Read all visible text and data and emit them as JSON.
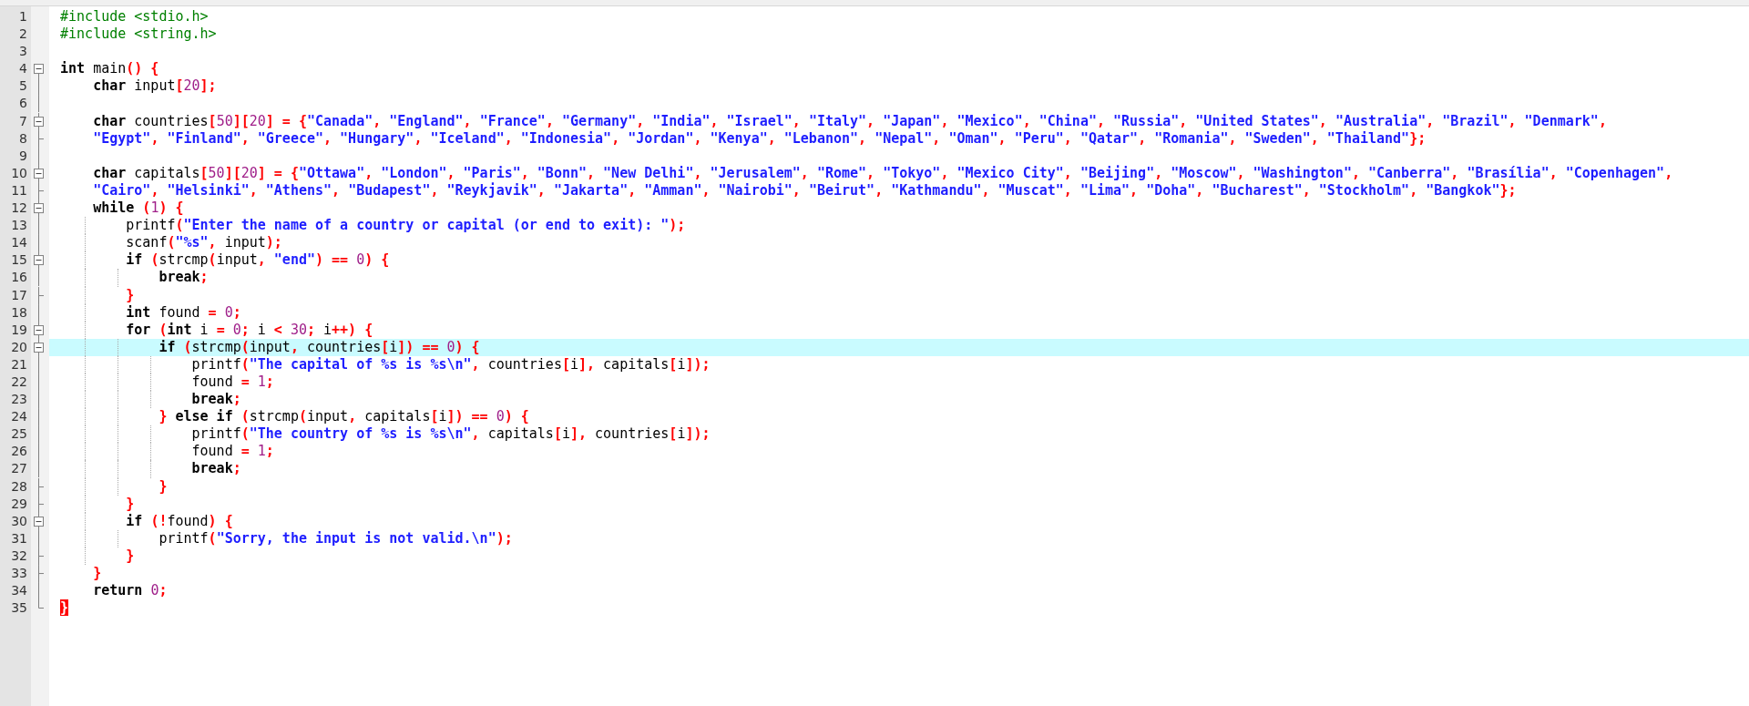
{
  "editor": {
    "lines": [
      {
        "number": "1",
        "kind": "plain",
        "current": false,
        "tokens": [
          {
            "kind": "pp",
            "text": "#include <stdio.h>"
          }
        ]
      },
      {
        "number": "2",
        "kind": "plain",
        "current": false,
        "tokens": [
          {
            "kind": "pp",
            "text": "#include <string.h>"
          }
        ]
      },
      {
        "number": "3",
        "kind": "plain",
        "current": false
      },
      {
        "number": "4",
        "kind": "fold-open",
        "current": false,
        "tokens": [
          {
            "kind": "kw",
            "text": "int"
          },
          {
            "kind": "id",
            "text": " main"
          },
          {
            "kind": "op",
            "text": "() {"
          }
        ]
      },
      {
        "number": "5",
        "kind": "fold-body",
        "current": false,
        "tokens": [
          {
            "kind": "kw",
            "text": "    char"
          },
          {
            "kind": "id",
            "text": " input"
          },
          {
            "kind": "op",
            "text": "["
          },
          {
            "kind": "num",
            "text": "20"
          },
          {
            "kind": "op",
            "text": "];"
          }
        ]
      },
      {
        "number": "6",
        "kind": "fold-body",
        "current": false
      },
      {
        "number": "7",
        "kind": "fold-open",
        "current": false,
        "tokens": [
          {
            "kind": "kw",
            "text": "    char"
          },
          {
            "kind": "id",
            "text": " countries"
          },
          {
            "kind": "op",
            "text": "["
          },
          {
            "kind": "num",
            "text": "50"
          },
          {
            "kind": "op",
            "text": "]["
          },
          {
            "kind": "num",
            "text": "20"
          },
          {
            "kind": "op",
            "text": "] = {"
          },
          {
            "kind": "str",
            "text": "\"Canada\""
          },
          {
            "kind": "op",
            "text": ", "
          },
          {
            "kind": "str",
            "text": "\"England\""
          },
          {
            "kind": "op",
            "text": ", "
          },
          {
            "kind": "str",
            "text": "\"France\""
          },
          {
            "kind": "op",
            "text": ", "
          },
          {
            "kind": "str",
            "text": "\"Germany\""
          },
          {
            "kind": "op",
            "text": ", "
          },
          {
            "kind": "str",
            "text": "\"India\""
          },
          {
            "kind": "op",
            "text": ", "
          },
          {
            "kind": "str",
            "text": "\"Israel\""
          },
          {
            "kind": "op",
            "text": ", "
          },
          {
            "kind": "str",
            "text": "\"Italy\""
          },
          {
            "kind": "op",
            "text": ", "
          },
          {
            "kind": "str",
            "text": "\"Japan\""
          },
          {
            "kind": "op",
            "text": ", "
          },
          {
            "kind": "str",
            "text": "\"Mexico\""
          },
          {
            "kind": "op",
            "text": ", "
          },
          {
            "kind": "str",
            "text": "\"China\""
          },
          {
            "kind": "op",
            "text": ", "
          },
          {
            "kind": "str",
            "text": "\"Russia\""
          },
          {
            "kind": "op",
            "text": ", "
          },
          {
            "kind": "str",
            "text": "\"United States\""
          },
          {
            "kind": "op",
            "text": ", "
          },
          {
            "kind": "str",
            "text": "\"Australia\""
          },
          {
            "kind": "op",
            "text": ", "
          },
          {
            "kind": "str",
            "text": "\"Brazil\""
          },
          {
            "kind": "op",
            "text": ", "
          },
          {
            "kind": "str",
            "text": "\"Denmark\""
          },
          {
            "kind": "op",
            "text": ","
          }
        ]
      },
      {
        "number": "8",
        "kind": "fold-end",
        "current": false,
        "tokens": [
          {
            "kind": "str",
            "text": "    \"Egypt\""
          },
          {
            "kind": "op",
            "text": ", "
          },
          {
            "kind": "str",
            "text": "\"Finland\""
          },
          {
            "kind": "op",
            "text": ", "
          },
          {
            "kind": "str",
            "text": "\"Greece\""
          },
          {
            "kind": "op",
            "text": ", "
          },
          {
            "kind": "str",
            "text": "\"Hungary\""
          },
          {
            "kind": "op",
            "text": ", "
          },
          {
            "kind": "str",
            "text": "\"Iceland\""
          },
          {
            "kind": "op",
            "text": ", "
          },
          {
            "kind": "str",
            "text": "\"Indonesia\""
          },
          {
            "kind": "op",
            "text": ", "
          },
          {
            "kind": "str",
            "text": "\"Jordan\""
          },
          {
            "kind": "op",
            "text": ", "
          },
          {
            "kind": "str",
            "text": "\"Kenya\""
          },
          {
            "kind": "op",
            "text": ", "
          },
          {
            "kind": "str",
            "text": "\"Lebanon\""
          },
          {
            "kind": "op",
            "text": ", "
          },
          {
            "kind": "str",
            "text": "\"Nepal\""
          },
          {
            "kind": "op",
            "text": ", "
          },
          {
            "kind": "str",
            "text": "\"Oman\""
          },
          {
            "kind": "op",
            "text": ", "
          },
          {
            "kind": "str",
            "text": "\"Peru\""
          },
          {
            "kind": "op",
            "text": ", "
          },
          {
            "kind": "str",
            "text": "\"Qatar\""
          },
          {
            "kind": "op",
            "text": ", "
          },
          {
            "kind": "str",
            "text": "\"Romania\""
          },
          {
            "kind": "op",
            "text": ", "
          },
          {
            "kind": "str",
            "text": "\"Sweden\""
          },
          {
            "kind": "op",
            "text": ", "
          },
          {
            "kind": "str",
            "text": "\"Thailand\""
          },
          {
            "kind": "op",
            "text": "};"
          }
        ]
      },
      {
        "number": "9",
        "kind": "fold-body",
        "current": false
      },
      {
        "number": "10",
        "kind": "fold-open",
        "current": false,
        "tokens": [
          {
            "kind": "kw",
            "text": "    char"
          },
          {
            "kind": "id",
            "text": " capitals"
          },
          {
            "kind": "op",
            "text": "["
          },
          {
            "kind": "num",
            "text": "50"
          },
          {
            "kind": "op",
            "text": "]["
          },
          {
            "kind": "num",
            "text": "20"
          },
          {
            "kind": "op",
            "text": "] = {"
          },
          {
            "kind": "str",
            "text": "\"Ottawa\""
          },
          {
            "kind": "op",
            "text": ", "
          },
          {
            "kind": "str",
            "text": "\"London\""
          },
          {
            "kind": "op",
            "text": ", "
          },
          {
            "kind": "str",
            "text": "\"Paris\""
          },
          {
            "kind": "op",
            "text": ", "
          },
          {
            "kind": "str",
            "text": "\"Bonn\""
          },
          {
            "kind": "op",
            "text": ", "
          },
          {
            "kind": "str",
            "text": "\"New Delhi\""
          },
          {
            "kind": "op",
            "text": ", "
          },
          {
            "kind": "str",
            "text": "\"Jerusalem\""
          },
          {
            "kind": "op",
            "text": ", "
          },
          {
            "kind": "str",
            "text": "\"Rome\""
          },
          {
            "kind": "op",
            "text": ", "
          },
          {
            "kind": "str",
            "text": "\"Tokyo\""
          },
          {
            "kind": "op",
            "text": ", "
          },
          {
            "kind": "str",
            "text": "\"Mexico City\""
          },
          {
            "kind": "op",
            "text": ", "
          },
          {
            "kind": "str",
            "text": "\"Beijing\""
          },
          {
            "kind": "op",
            "text": ", "
          },
          {
            "kind": "str",
            "text": "\"Moscow\""
          },
          {
            "kind": "op",
            "text": ", "
          },
          {
            "kind": "str",
            "text": "\"Washington\""
          },
          {
            "kind": "op",
            "text": ", "
          },
          {
            "kind": "str",
            "text": "\"Canberra\""
          },
          {
            "kind": "op",
            "text": ", "
          },
          {
            "kind": "str",
            "text": "\"Brasília\""
          },
          {
            "kind": "op",
            "text": ", "
          },
          {
            "kind": "str",
            "text": "\"Copenhagen\""
          },
          {
            "kind": "op",
            "text": ","
          }
        ]
      },
      {
        "number": "11",
        "kind": "fold-end",
        "current": false,
        "tokens": [
          {
            "kind": "str",
            "text": "    \"Cairo\""
          },
          {
            "kind": "op",
            "text": ", "
          },
          {
            "kind": "str",
            "text": "\"Helsinki\""
          },
          {
            "kind": "op",
            "text": ", "
          },
          {
            "kind": "str",
            "text": "\"Athens\""
          },
          {
            "kind": "op",
            "text": ", "
          },
          {
            "kind": "str",
            "text": "\"Budapest\""
          },
          {
            "kind": "op",
            "text": ", "
          },
          {
            "kind": "str",
            "text": "\"Reykjavik\""
          },
          {
            "kind": "op",
            "text": ", "
          },
          {
            "kind": "str",
            "text": "\"Jakarta\""
          },
          {
            "kind": "op",
            "text": ", "
          },
          {
            "kind": "str",
            "text": "\"Amman\""
          },
          {
            "kind": "op",
            "text": ", "
          },
          {
            "kind": "str",
            "text": "\"Nairobi\""
          },
          {
            "kind": "op",
            "text": ", "
          },
          {
            "kind": "str",
            "text": "\"Beirut\""
          },
          {
            "kind": "op",
            "text": ", "
          },
          {
            "kind": "str",
            "text": "\"Kathmandu\""
          },
          {
            "kind": "op",
            "text": ", "
          },
          {
            "kind": "str",
            "text": "\"Muscat\""
          },
          {
            "kind": "op",
            "text": ", "
          },
          {
            "kind": "str",
            "text": "\"Lima\""
          },
          {
            "kind": "op",
            "text": ", "
          },
          {
            "kind": "str",
            "text": "\"Doha\""
          },
          {
            "kind": "op",
            "text": ", "
          },
          {
            "kind": "str",
            "text": "\"Bucharest\""
          },
          {
            "kind": "op",
            "text": ", "
          },
          {
            "kind": "str",
            "text": "\"Stockholm\""
          },
          {
            "kind": "op",
            "text": ", "
          },
          {
            "kind": "str",
            "text": "\"Bangkok\""
          },
          {
            "kind": "op",
            "text": "};"
          }
        ]
      },
      {
        "number": "12",
        "kind": "fold-open",
        "current": false,
        "tokens": [
          {
            "kind": "kw",
            "text": "    while "
          },
          {
            "kind": "op",
            "text": "("
          },
          {
            "kind": "num",
            "text": "1"
          },
          {
            "kind": "op",
            "text": ") {"
          }
        ]
      },
      {
        "number": "13",
        "kind": "fold-body",
        "current": false,
        "tokens": [
          {
            "kind": "id",
            "text": "        printf"
          },
          {
            "kind": "op",
            "text": "("
          },
          {
            "kind": "str",
            "text": "\"Enter the name of a country or capital (or end to exit): \""
          },
          {
            "kind": "op",
            "text": ");"
          }
        ]
      },
      {
        "number": "14",
        "kind": "fold-body",
        "current": false,
        "tokens": [
          {
            "kind": "id",
            "text": "        scanf"
          },
          {
            "kind": "op",
            "text": "("
          },
          {
            "kind": "str",
            "text": "\"%s\""
          },
          {
            "kind": "op",
            "text": ", "
          },
          {
            "kind": "id",
            "text": "input"
          },
          {
            "kind": "op",
            "text": ");"
          }
        ]
      },
      {
        "number": "15",
        "kind": "fold-open",
        "current": false,
        "tokens": [
          {
            "kind": "kw",
            "text": "        if "
          },
          {
            "kind": "op",
            "text": "("
          },
          {
            "kind": "id",
            "text": "strcmp"
          },
          {
            "kind": "op",
            "text": "("
          },
          {
            "kind": "id",
            "text": "input"
          },
          {
            "kind": "op",
            "text": ", "
          },
          {
            "kind": "str",
            "text": "\"end\""
          },
          {
            "kind": "op",
            "text": ") == "
          },
          {
            "kind": "num",
            "text": "0"
          },
          {
            "kind": "op",
            "text": ") {"
          }
        ]
      },
      {
        "number": "16",
        "kind": "fold-body",
        "current": false,
        "tokens": [
          {
            "kind": "kw",
            "text": "            break"
          },
          {
            "kind": "op",
            "text": ";"
          }
        ]
      },
      {
        "number": "17",
        "kind": "fold-end",
        "current": false,
        "tokens": [
          {
            "kind": "op",
            "text": "        }"
          }
        ]
      },
      {
        "number": "18",
        "kind": "fold-body",
        "current": false,
        "tokens": [
          {
            "kind": "kw",
            "text": "        int"
          },
          {
            "kind": "id",
            "text": " found "
          },
          {
            "kind": "op",
            "text": "= "
          },
          {
            "kind": "num",
            "text": "0"
          },
          {
            "kind": "op",
            "text": ";"
          }
        ]
      },
      {
        "number": "19",
        "kind": "fold-open",
        "current": false,
        "tokens": [
          {
            "kind": "kw",
            "text": "        for "
          },
          {
            "kind": "op",
            "text": "("
          },
          {
            "kind": "kw",
            "text": "int"
          },
          {
            "kind": "id",
            "text": " i "
          },
          {
            "kind": "op",
            "text": "= "
          },
          {
            "kind": "num",
            "text": "0"
          },
          {
            "kind": "op",
            "text": "; "
          },
          {
            "kind": "id",
            "text": "i "
          },
          {
            "kind": "op",
            "text": "< "
          },
          {
            "kind": "num",
            "text": "30"
          },
          {
            "kind": "op",
            "text": "; "
          },
          {
            "kind": "id",
            "text": "i"
          },
          {
            "kind": "op",
            "text": "++) {"
          }
        ]
      },
      {
        "number": "20",
        "kind": "fold-open",
        "current": true,
        "tokens": [
          {
            "kind": "kw",
            "text": "            if "
          },
          {
            "kind": "op",
            "text": "("
          },
          {
            "kind": "id",
            "text": "strcmp"
          },
          {
            "kind": "op",
            "text": "("
          },
          {
            "kind": "id",
            "text": "input"
          },
          {
            "kind": "op",
            "text": ", "
          },
          {
            "kind": "id",
            "text": "countries"
          },
          {
            "kind": "op",
            "text": "["
          },
          {
            "kind": "id",
            "text": "i"
          },
          {
            "kind": "op",
            "text": "]) == "
          },
          {
            "kind": "num",
            "text": "0"
          },
          {
            "kind": "op",
            "text": ") {"
          }
        ]
      },
      {
        "number": "21",
        "kind": "fold-body",
        "current": false,
        "tokens": [
          {
            "kind": "id",
            "text": "                printf"
          },
          {
            "kind": "op",
            "text": "("
          },
          {
            "kind": "str",
            "text": "\"The capital of %s is %s\\n\""
          },
          {
            "kind": "op",
            "text": ", "
          },
          {
            "kind": "id",
            "text": "countries"
          },
          {
            "kind": "op",
            "text": "["
          },
          {
            "kind": "id",
            "text": "i"
          },
          {
            "kind": "op",
            "text": "], "
          },
          {
            "kind": "id",
            "text": "capitals"
          },
          {
            "kind": "op",
            "text": "["
          },
          {
            "kind": "id",
            "text": "i"
          },
          {
            "kind": "op",
            "text": "]);"
          }
        ]
      },
      {
        "number": "22",
        "kind": "fold-body",
        "current": false,
        "tokens": [
          {
            "kind": "id",
            "text": "                found "
          },
          {
            "kind": "op",
            "text": "= "
          },
          {
            "kind": "num",
            "text": "1"
          },
          {
            "kind": "op",
            "text": ";"
          }
        ]
      },
      {
        "number": "23",
        "kind": "fold-body",
        "current": false,
        "tokens": [
          {
            "kind": "kw",
            "text": "                break"
          },
          {
            "kind": "op",
            "text": ";"
          }
        ]
      },
      {
        "number": "24",
        "kind": "fold-body",
        "current": false,
        "tokens": [
          {
            "kind": "op",
            "text": "            } "
          },
          {
            "kind": "kw",
            "text": "else if "
          },
          {
            "kind": "op",
            "text": "("
          },
          {
            "kind": "id",
            "text": "strcmp"
          },
          {
            "kind": "op",
            "text": "("
          },
          {
            "kind": "id",
            "text": "input"
          },
          {
            "kind": "op",
            "text": ", "
          },
          {
            "kind": "id",
            "text": "capitals"
          },
          {
            "kind": "op",
            "text": "["
          },
          {
            "kind": "id",
            "text": "i"
          },
          {
            "kind": "op",
            "text": "]) == "
          },
          {
            "kind": "num",
            "text": "0"
          },
          {
            "kind": "op",
            "text": ") {"
          }
        ]
      },
      {
        "number": "25",
        "kind": "fold-body",
        "current": false,
        "tokens": [
          {
            "kind": "id",
            "text": "                printf"
          },
          {
            "kind": "op",
            "text": "("
          },
          {
            "kind": "str",
            "text": "\"The country of %s is %s\\n\""
          },
          {
            "kind": "op",
            "text": ", "
          },
          {
            "kind": "id",
            "text": "capitals"
          },
          {
            "kind": "op",
            "text": "["
          },
          {
            "kind": "id",
            "text": "i"
          },
          {
            "kind": "op",
            "text": "], "
          },
          {
            "kind": "id",
            "text": "countries"
          },
          {
            "kind": "op",
            "text": "["
          },
          {
            "kind": "id",
            "text": "i"
          },
          {
            "kind": "op",
            "text": "]);"
          }
        ]
      },
      {
        "number": "26",
        "kind": "fold-body",
        "current": false,
        "tokens": [
          {
            "kind": "id",
            "text": "                found "
          },
          {
            "kind": "op",
            "text": "= "
          },
          {
            "kind": "num",
            "text": "1"
          },
          {
            "kind": "op",
            "text": ";"
          }
        ]
      },
      {
        "number": "27",
        "kind": "fold-body",
        "current": false,
        "tokens": [
          {
            "kind": "kw",
            "text": "                break"
          },
          {
            "kind": "op",
            "text": ";"
          }
        ]
      },
      {
        "number": "28",
        "kind": "fold-end",
        "current": false,
        "tokens": [
          {
            "kind": "op",
            "text": "            }"
          }
        ]
      },
      {
        "number": "29",
        "kind": "fold-end",
        "current": false,
        "tokens": [
          {
            "kind": "op",
            "text": "        }"
          }
        ]
      },
      {
        "number": "30",
        "kind": "fold-open",
        "current": false,
        "tokens": [
          {
            "kind": "kw",
            "text": "        if "
          },
          {
            "kind": "op",
            "text": "(!"
          },
          {
            "kind": "id",
            "text": "found"
          },
          {
            "kind": "op",
            "text": ") {"
          }
        ]
      },
      {
        "number": "31",
        "kind": "fold-body",
        "current": false,
        "tokens": [
          {
            "kind": "id",
            "text": "            printf"
          },
          {
            "kind": "op",
            "text": "("
          },
          {
            "kind": "str",
            "text": "\"Sorry, the input is not valid.\\n\""
          },
          {
            "kind": "op",
            "text": ");"
          }
        ]
      },
      {
        "number": "32",
        "kind": "fold-end",
        "current": false,
        "tokens": [
          {
            "kind": "op",
            "text": "        }"
          }
        ]
      },
      {
        "number": "33",
        "kind": "fold-end",
        "current": false,
        "tokens": [
          {
            "kind": "op",
            "text": "    }"
          }
        ]
      },
      {
        "number": "34",
        "kind": "fold-body",
        "current": false,
        "tokens": [
          {
            "kind": "kw",
            "text": "    return "
          },
          {
            "kind": "num",
            "text": "0"
          },
          {
            "kind": "op",
            "text": ";"
          }
        ]
      },
      {
        "number": "35",
        "kind": "fold-last",
        "current": false,
        "tokens": [
          {
            "kind": "err",
            "text": "}"
          }
        ]
      }
    ]
  }
}
